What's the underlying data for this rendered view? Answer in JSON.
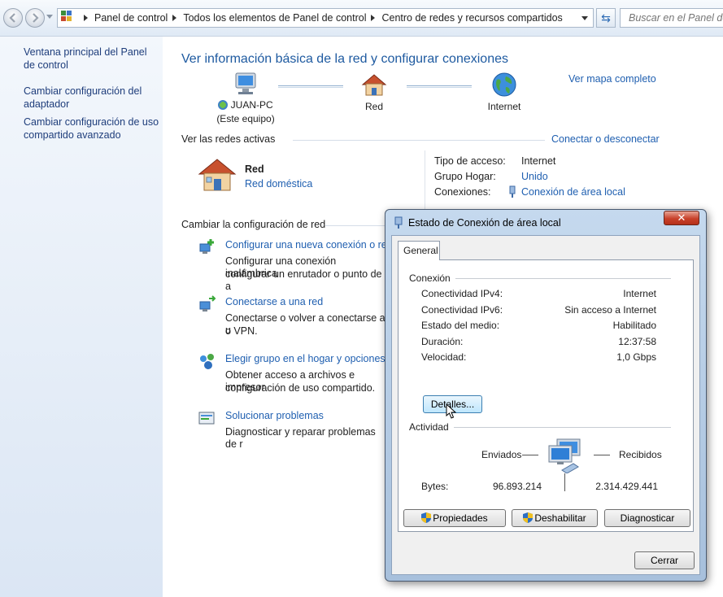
{
  "address": {
    "crumbs": [
      "Panel de control",
      "Todos los elementos de Panel de control",
      "Centro de redes y recursos compartidos"
    ],
    "search_placeholder": "Buscar en el Panel de control"
  },
  "sidebar": {
    "items": [
      {
        "label": "Ventana principal del Panel de control"
      },
      {
        "label": "Cambiar configuración del adaptador"
      },
      {
        "label": "Cambiar configuración de uso compartido avanzado"
      }
    ]
  },
  "main": {
    "title": "Ver información básica de la red y configurar conexiones",
    "full_map_link": "Ver mapa completo",
    "map": {
      "computer": "JUAN-PC",
      "computer_sub": "(Este equipo)",
      "network": "Red",
      "internet": "Internet"
    },
    "active_title": "Ver las redes activas",
    "connect_link": "Conectar o desconectar",
    "network_name": "Red",
    "network_type": "Red doméstica",
    "props": {
      "access_label": "Tipo de acceso:",
      "access_value": "Internet",
      "homegroup_label": "Grupo Hogar:",
      "homegroup_value": "Unido",
      "connections_label": "Conexiones:",
      "connections_value": "Conexión de área local"
    },
    "change_title": "Cambiar la configuración de red",
    "tasks": [
      {
        "link": "Configurar una nueva conexión o red",
        "desc1": "Configurar una conexión inalámbrica",
        "desc2": "configurar un enrutador o punto de a"
      },
      {
        "link": "Conectarse a una red",
        "desc1": "Conectarse o volver a conectarse a u",
        "desc2": "o VPN."
      },
      {
        "link": "Elegir grupo en el hogar y opciones d",
        "desc1": "Obtener acceso a archivos e impresor",
        "desc2": "configuración de uso compartido."
      },
      {
        "link": "Solucionar problemas",
        "desc1": "Diagnosticar y reparar problemas de r",
        "desc2": ""
      }
    ]
  },
  "dialog": {
    "title": "Estado de Conexión de área local",
    "close": "✕",
    "tab": "General",
    "connection_group": "Conexión",
    "rows": [
      {
        "label": "Conectividad IPv4:",
        "value": "Internet"
      },
      {
        "label": "Conectividad IPv6:",
        "value": "Sin acceso a Internet"
      },
      {
        "label": "Estado del medio:",
        "value": "Habilitado"
      },
      {
        "label": "Duración:",
        "value": "12:37:58"
      },
      {
        "label": "Velocidad:",
        "value": "1,0 Gbps"
      }
    ],
    "details_button": "Detalles...",
    "activity_group": "Actividad",
    "sent_label": "Enviados",
    "received_label": "Recibidos",
    "bytes_label": "Bytes:",
    "bytes_sent": "96.893.214",
    "bytes_received": "2.314.429.441",
    "properties_button": "Propiedades",
    "disable_button": "Deshabilitar",
    "diagnose_button": "Diagnosticar",
    "close_button": "Cerrar"
  }
}
